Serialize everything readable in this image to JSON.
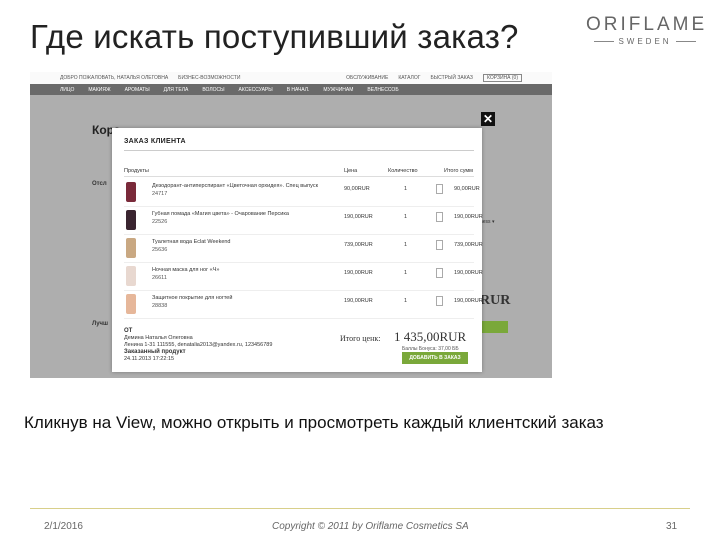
{
  "slide": {
    "title": "Где искать поступивший заказ?",
    "caption": "Кликнув на View, можно открыть и просмотреть каждый клиентский заказ",
    "footer_date": "2/1/2016",
    "footer_copyright": "Copyright © 2011 by Oriflame Cosmetics SA",
    "footer_page": "31"
  },
  "logo": {
    "word": "ORIFLAME",
    "sub": "SWEDEN"
  },
  "site": {
    "topnav": [
      "ДОБРО ПОЖАЛОВАТЬ, НАТАЛЬЯ ОЛЕГОВНА",
      "БИЗНЕС-ВОЗМОЖНОСТИ"
    ],
    "topnav_right": [
      "ОБСЛУЖИВАНИЕ",
      "КАТАЛОГ",
      "БЫСТРЫЙ ЗАКАЗ"
    ],
    "cart": "КОРЗИНА (0)",
    "catnav": [
      "ЛИЦО",
      "МАКИЯЖ",
      "АРОМАТЫ",
      "ДЛЯ ТЕЛА",
      "ВОЛОСЫ",
      "АКСЕССУАРЫ",
      "В НАЧАЛ.",
      "МУЖЧИНАМ",
      "ВЕЛНЕССОБ"
    ],
    "page_heading": "Корз",
    "side_labels": [
      "Отсл",
      "Лучш"
    ],
    "ghost_price": "RUR",
    "ghost_select": "ness ▾"
  },
  "modal": {
    "close": "✕",
    "title": "ЗАКАЗ КЛИЕНТА",
    "headers": {
      "product": "Продукты",
      "price": "Цена",
      "qty": "Количество",
      "total": "Итого сумм"
    },
    "items": [
      {
        "name": "Дезодорант-антиперспирант «Цветочная орхидея». Спец выпуск",
        "code": "24717",
        "price": "90,00RUR",
        "qty": "1",
        "total": "90,00RUR",
        "color": "#7a2a3a"
      },
      {
        "name": "Губная помада «Магия цвета» - Очарование Персика",
        "code": "22526",
        "price": "190,00RUR",
        "qty": "1",
        "total": "190,00RUR",
        "color": "#3a2530"
      },
      {
        "name": "Туалетная вода Eclat Weekend",
        "code": "25636",
        "price": "739,00RUR",
        "qty": "1",
        "total": "739,00RUR",
        "color": "#c9a882"
      },
      {
        "name": "Ночная маска для ног «Ч»",
        "code": "26611",
        "price": "190,00RUR",
        "qty": "1",
        "total": "190,00RUR",
        "color": "#e8d8d0"
      },
      {
        "name": "Защитное покрытие для ногтей",
        "code": "28838",
        "price": "190,00RUR",
        "qty": "1",
        "total": "190,00RUR",
        "color": "#e6b79a"
      }
    ],
    "from_label": "ОТ",
    "from_name": "Демина Наталья Олеговна",
    "from_addr": "Ленина 1-31 111555, denatalia2013@yandex.ru, 123456789",
    "status": "Заказанный продукт",
    "date": "24.11.2013 17:22:15",
    "total_label": "Итого ценк:",
    "total_value": "1 435,00RUR",
    "points": "Баллы Бонуса: 37,00 ББ",
    "add_button": "ДОБАВИТЬ В ЗАКАЗ"
  }
}
